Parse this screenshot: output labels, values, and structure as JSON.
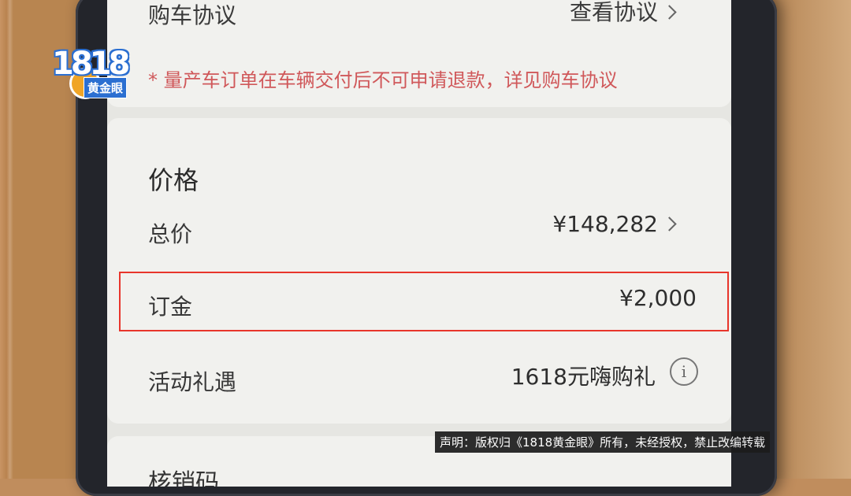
{
  "agreement": {
    "label": "购车协议",
    "link": "查看协议"
  },
  "notice": "* 量产车订单在车辆交付后不可申请退款，详见购车协议",
  "price": {
    "title": "价格",
    "total_label": "总价",
    "total_value": "¥148,282",
    "deposit_label": "订金",
    "deposit_value": "¥2,000",
    "promo_label": "活动礼遇",
    "promo_value": "1618元嗨购礼"
  },
  "next_section_label": "核销码",
  "watermark": {
    "number": "1818",
    "name": "黄金眼"
  },
  "disclaimer": "声明：版权归《1818黄金眼》所有，未经授权，禁止改编转载",
  "colors": {
    "notice": "#d0585a",
    "highlight_box": "#e8352b",
    "logo_blue": "#2b6fd1"
  }
}
